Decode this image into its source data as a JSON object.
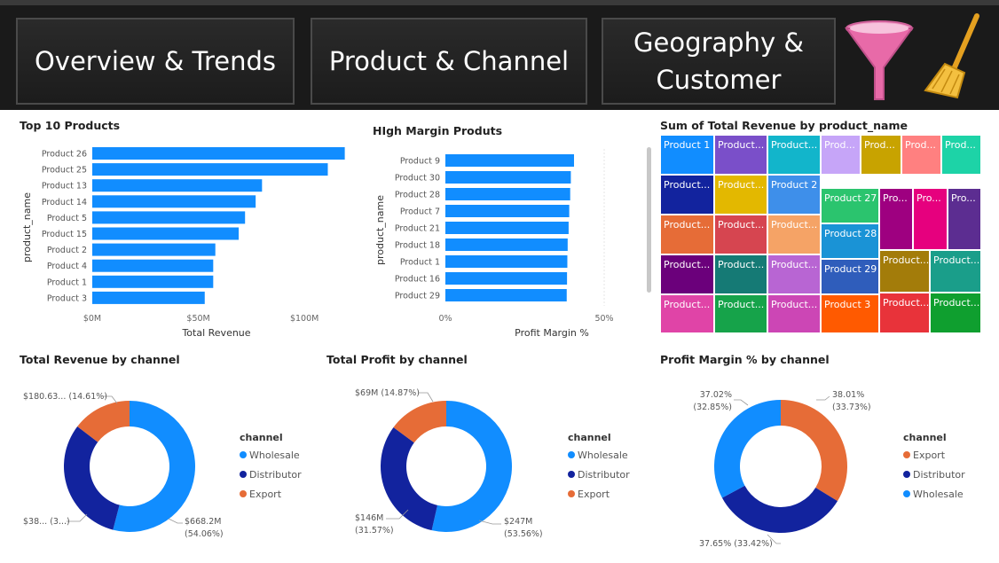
{
  "nav": {
    "tabs": [
      {
        "label": "Overview & Trends"
      },
      {
        "label": "Product & Channel"
      },
      {
        "label": "Geography &\nCustomer"
      }
    ]
  },
  "icons": {
    "filter": "funnel-icon",
    "clear": "broom-icon"
  },
  "chart_data": [
    {
      "type": "bar",
      "orientation": "horizontal",
      "title": "Top 10 Products",
      "xlabel": "Total Revenue",
      "ylabel": "product_name",
      "categories": [
        "Product 26",
        "Product 25",
        "Product 13",
        "Product 14",
        "Product 5",
        "Product 15",
        "Product 2",
        "Product 4",
        "Product 1",
        "Product 3"
      ],
      "values": [
        119,
        111,
        80,
        77,
        72,
        69,
        58,
        57,
        57,
        53
      ],
      "unit": "$M",
      "xlim": [
        0,
        120
      ],
      "ticks": [
        {
          "v": 0,
          "label": "$0M"
        },
        {
          "v": 50,
          "label": "$50M"
        },
        {
          "v": 100,
          "label": "$100M"
        }
      ],
      "color": "#118DFF"
    },
    {
      "type": "bar",
      "orientation": "horizontal",
      "title": "HIgh Margin Produts",
      "xlabel": "Profit Margin %",
      "ylabel": "product_name",
      "categories": [
        "Product 9",
        "Product 30",
        "Product 28",
        "Product 7",
        "Product 21",
        "Product 18",
        "Product 1",
        "Product 16",
        "Product 29"
      ],
      "values": [
        40.5,
        39.5,
        39.3,
        39.0,
        38.8,
        38.5,
        38.4,
        38.3,
        38.2
      ],
      "xlim": [
        0,
        50
      ],
      "ticks": [
        {
          "v": 0,
          "label": "0%"
        },
        {
          "v": 50,
          "label": "50%"
        }
      ],
      "color": "#118DFF"
    },
    {
      "type": "treemap",
      "title": "Sum of Total Revenue by product_name",
      "cells": [
        {
          "label": "Product 1",
          "color": "#118DFF"
        },
        {
          "label": "Product...",
          "color": "#7A4FC9"
        },
        {
          "label": "Product...",
          "color": "#12B5CB"
        },
        {
          "label": "Prod...",
          "color": "#C6A5F8"
        },
        {
          "label": "Prod...",
          "color": "#C8A300"
        },
        {
          "label": "Prod...",
          "color": "#FF8080"
        },
        {
          "label": "Prod...",
          "color": "#1DD3A7"
        },
        {
          "label": "Product...",
          "color": "#12239E"
        },
        {
          "label": "Product...",
          "color": "#E3B800"
        },
        {
          "label": "Product 2",
          "color": "#3E8FEA"
        },
        {
          "label": "Product 27",
          "color": "#2BC46E"
        },
        {
          "label": "Pro...",
          "color": "#9E0080"
        },
        {
          "label": "Pro...",
          "color": "#E6007E"
        },
        {
          "label": "Pro...",
          "color": "#5C2D91"
        },
        {
          "label": "Product...",
          "color": "#E66C37"
        },
        {
          "label": "Product...",
          "color": "#D64550"
        },
        {
          "label": "Product...",
          "color": "#F5A366"
        },
        {
          "label": "Product 28",
          "color": "#1A93D6"
        },
        {
          "label": "Product...",
          "color": "#6B007B"
        },
        {
          "label": "Product...",
          "color": "#157A75"
        },
        {
          "label": "Product...",
          "color": "#B865D3"
        },
        {
          "label": "Product 29",
          "color": "#2F5DBB"
        },
        {
          "label": "Product...",
          "color": "#A37C0A"
        },
        {
          "label": "Product...",
          "color": "#1A9E8A"
        },
        {
          "label": "Product...",
          "color": "#E044A7"
        },
        {
          "label": "Product...",
          "color": "#16A34A"
        },
        {
          "label": "Product...",
          "color": "#CC46B5"
        },
        {
          "label": "Product 3",
          "color": "#FF5A00"
        },
        {
          "label": "Product...",
          "color": "#E8333A"
        },
        {
          "label": "Product...",
          "color": "#0F9F2F"
        }
      ]
    },
    {
      "type": "donut",
      "title": "Total Revenue by channel",
      "legend_title": "channel",
      "slices": [
        {
          "name": "Wholesale",
          "value": 54.06,
          "color": "#118DFF",
          "label": "$668.2M",
          "label2": "(54.06%)"
        },
        {
          "name": "Distributor",
          "value": 31.33,
          "color": "#12239E",
          "label": "$38... (3...)",
          "label2": ""
        },
        {
          "name": "Export",
          "value": 14.61,
          "color": "#E66C37",
          "label": "$180.63... (14.61%)",
          "label2": ""
        }
      ]
    },
    {
      "type": "donut",
      "title": "Total Profit by channel",
      "legend_title": "channel",
      "slices": [
        {
          "name": "Wholesale",
          "value": 53.56,
          "color": "#118DFF",
          "label": "$247M",
          "label2": "(53.56%)"
        },
        {
          "name": "Distributor",
          "value": 31.57,
          "color": "#12239E",
          "label": "$146M",
          "label2": "(31.57%)"
        },
        {
          "name": "Export",
          "value": 14.87,
          "color": "#E66C37",
          "label": "$69M (14.87%)",
          "label2": ""
        }
      ]
    },
    {
      "type": "donut",
      "title": "Profit Margin % by channel",
      "legend_title": "channel",
      "slices": [
        {
          "name": "Export",
          "value": 33.73,
          "color": "#E66C37",
          "label": "38.01%",
          "label2": "(33.73%)"
        },
        {
          "name": "Distributor",
          "value": 33.42,
          "color": "#12239E",
          "label": "37.65% (33.42%)",
          "label2": ""
        },
        {
          "name": "Wholesale",
          "value": 32.85,
          "color": "#118DFF",
          "label": "37.02%",
          "label2": "(32.85%)"
        }
      ]
    }
  ]
}
